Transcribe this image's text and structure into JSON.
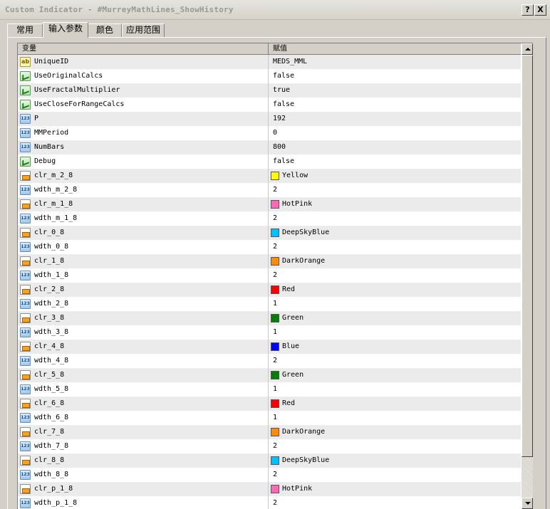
{
  "window": {
    "title": "Custom Indicator - #MurreyMathLines_ShowHistory",
    "help_label": "?",
    "close_label": "X"
  },
  "tabs": [
    {
      "label": "常用",
      "active": false
    },
    {
      "label": "输入参数",
      "active": true
    },
    {
      "label": "颜色",
      "active": false
    },
    {
      "label": "应用范围",
      "active": false
    }
  ],
  "grid": {
    "columns": [
      "变量",
      "赋值"
    ],
    "rows": [
      {
        "type": "str",
        "icon": "string-icon",
        "name": "UniqueID",
        "value": "MEDS_MML"
      },
      {
        "type": "bool",
        "icon": "boolean-icon",
        "name": "UseOriginalCalcs",
        "value": "false"
      },
      {
        "type": "bool",
        "icon": "boolean-icon",
        "name": "UseFractalMultiplier",
        "value": "true"
      },
      {
        "type": "bool",
        "icon": "boolean-icon",
        "name": "UseCloseForRangeCalcs",
        "value": "false"
      },
      {
        "type": "int",
        "icon": "integer-icon",
        "name": "P",
        "value": "192"
      },
      {
        "type": "int",
        "icon": "integer-icon",
        "name": "MMPeriod",
        "value": "0"
      },
      {
        "type": "int",
        "icon": "integer-icon",
        "name": "NumBars",
        "value": "800"
      },
      {
        "type": "bool",
        "icon": "boolean-icon",
        "name": "Debug",
        "value": "false"
      },
      {
        "type": "color",
        "icon": "color-icon",
        "name": "clr_m_2_8",
        "value": "Yellow",
        "swatch": "#ffff00"
      },
      {
        "type": "int",
        "icon": "integer-icon",
        "name": "wdth_m_2_8",
        "value": "2"
      },
      {
        "type": "color",
        "icon": "color-icon",
        "name": "clr_m_1_8",
        "value": "HotPink",
        "swatch": "#ff69b4"
      },
      {
        "type": "int",
        "icon": "integer-icon",
        "name": "wdth_m_1_8",
        "value": "2"
      },
      {
        "type": "color",
        "icon": "color-icon",
        "name": "clr_0_8",
        "value": "DeepSkyBlue",
        "swatch": "#00bfff"
      },
      {
        "type": "int",
        "icon": "integer-icon",
        "name": "wdth_0_8",
        "value": "2"
      },
      {
        "type": "color",
        "icon": "color-icon",
        "name": "clr_1_8",
        "value": "DarkOrange",
        "swatch": "#ff8c00"
      },
      {
        "type": "int",
        "icon": "integer-icon",
        "name": "wdth_1_8",
        "value": "2"
      },
      {
        "type": "color",
        "icon": "color-icon",
        "name": "clr_2_8",
        "value": "Red",
        "swatch": "#ff0000"
      },
      {
        "type": "int",
        "icon": "integer-icon",
        "name": "wdth_2_8",
        "value": "1"
      },
      {
        "type": "color",
        "icon": "color-icon",
        "name": "clr_3_8",
        "value": "Green",
        "swatch": "#008000"
      },
      {
        "type": "int",
        "icon": "integer-icon",
        "name": "wdth_3_8",
        "value": "1"
      },
      {
        "type": "color",
        "icon": "color-icon",
        "name": "clr_4_8",
        "value": "Blue",
        "swatch": "#0000ff"
      },
      {
        "type": "int",
        "icon": "integer-icon",
        "name": "wdth_4_8",
        "value": "2"
      },
      {
        "type": "color",
        "icon": "color-icon",
        "name": "clr_5_8",
        "value": "Green",
        "swatch": "#008000"
      },
      {
        "type": "int",
        "icon": "integer-icon",
        "name": "wdth_5_8",
        "value": "1"
      },
      {
        "type": "color",
        "icon": "color-icon",
        "name": "clr_6_8",
        "value": "Red",
        "swatch": "#ff0000"
      },
      {
        "type": "int",
        "icon": "integer-icon",
        "name": "wdth_6_8",
        "value": "1"
      },
      {
        "type": "color",
        "icon": "color-icon",
        "name": "clr_7_8",
        "value": "DarkOrange",
        "swatch": "#ff8c00"
      },
      {
        "type": "int",
        "icon": "integer-icon",
        "name": "wdth_7_8",
        "value": "2"
      },
      {
        "type": "color",
        "icon": "color-icon",
        "name": "clr_8_8",
        "value": "DeepSkyBlue",
        "swatch": "#00bfff"
      },
      {
        "type": "int",
        "icon": "integer-icon",
        "name": "wdth_8_8",
        "value": "2"
      },
      {
        "type": "color",
        "icon": "color-icon",
        "name": "clr_p_1_8",
        "value": "HotPink",
        "swatch": "#ff69b4"
      },
      {
        "type": "int",
        "icon": "integer-icon",
        "name": "wdth_p_1_8",
        "value": "2"
      }
    ]
  }
}
